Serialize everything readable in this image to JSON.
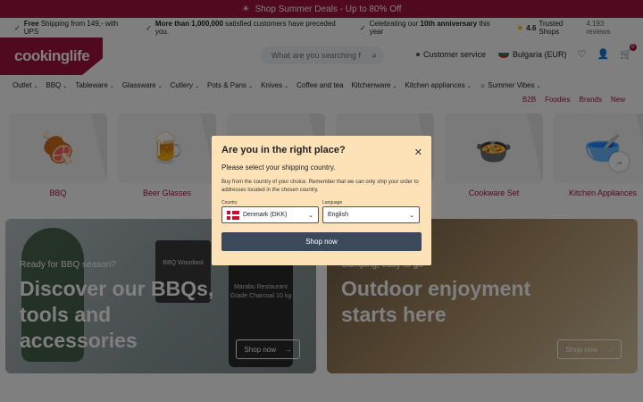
{
  "promo": {
    "icon": "sun-icon",
    "text": "Shop Summer Deals - Up to 80% Off"
  },
  "usp": {
    "items": [
      {
        "bold": "Free",
        "text": " Shipping from 149,- with UPS"
      },
      {
        "bold": "More than 1,000,000",
        "text": " satisfied customers have preceded you."
      },
      {
        "pre": "Celebrating our ",
        "bold": "10th anniversary",
        "text": " this year"
      }
    ],
    "trust": {
      "rating": "4.6",
      "label": "Trusted Shops",
      "reviews": "4.193 reviews"
    }
  },
  "logo": {
    "text": "cookinglife"
  },
  "search": {
    "placeholder": "What are you searching for?"
  },
  "header": {
    "customer_service": "Customer service",
    "country": "Bulgaria (EUR)",
    "cart_count": "0",
    "icons": [
      "heart-icon",
      "user-icon",
      "cart-icon"
    ]
  },
  "nav": {
    "items": [
      "Outlet",
      "BBQ",
      "Tableware",
      "Glassware",
      "Cutlery",
      "Pots & Pans",
      "Knives",
      "Coffee and tea",
      "Kitchenware",
      "Kitchen appliances",
      "Summer Vibes"
    ],
    "no_chevron": [
      "Coffee and tea"
    ],
    "sub": [
      "B2B",
      "Foodies",
      "Brands",
      "New"
    ]
  },
  "categories": [
    {
      "label": "BBQ",
      "icon": "grill-icon",
      "glyph": "🍖"
    },
    {
      "label": "Beer Glasses",
      "icon": "beer-glasses-icon",
      "glyph": "🍺"
    },
    {
      "label": "",
      "icon": "hidden-icon",
      "glyph": ""
    },
    {
      "label": "",
      "icon": "hidden-icon",
      "glyph": ""
    },
    {
      "label": "Cookware Set",
      "icon": "cookware-icon",
      "glyph": "🍲"
    },
    {
      "label": "Kitchen Appliances",
      "icon": "mixer-icon",
      "glyph": "🥣"
    }
  ],
  "banners": {
    "left": {
      "kicker": "Ready for BBQ season?",
      "headline": "Discover our BBQs, tools and accessories",
      "cta": "Shop now",
      "bag_small": "BBQ Woodwol",
      "bag_large": "Marabu Restaurant Grade Charcoal 10 kg"
    },
    "right": {
      "kicker": "Camping, easy to go",
      "headline": "Outdoor enjoyment starts here",
      "cta": "Shop now"
    }
  },
  "modal": {
    "title": "Are you in the right place?",
    "subtitle": "Please select your shipping country.",
    "description": "Buy from the country of your choice. Remember that we can only ship your order to addresses located in the chosen country.",
    "country_label": "Country",
    "country_value": "Denmark (DKK)",
    "language_label": "Language",
    "language_value": "English",
    "button": "Shop now"
  },
  "colors": {
    "brand": "#a3123f",
    "modal_bg": "#fde2b8",
    "button": "#3b4a5a"
  }
}
